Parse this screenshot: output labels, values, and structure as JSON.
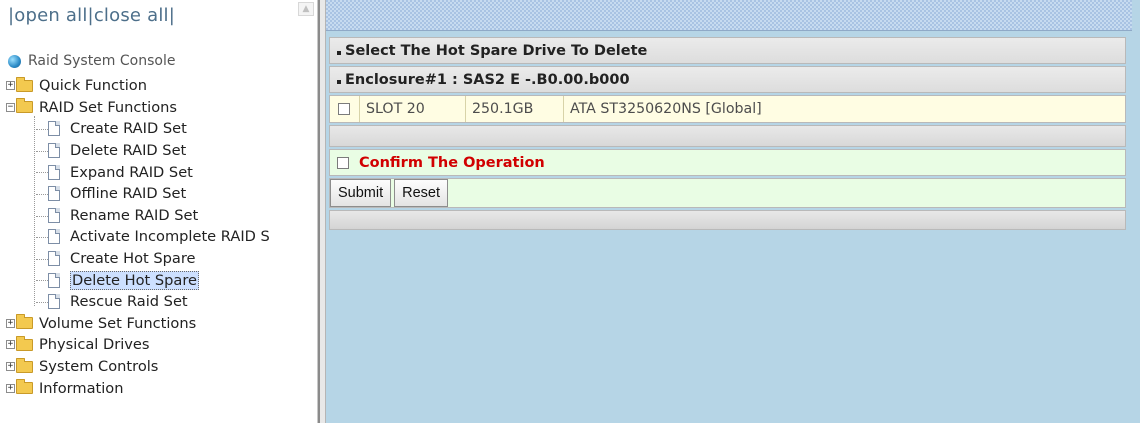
{
  "left": {
    "open_all": "open all",
    "close_all": "close all",
    "sep": "|",
    "root_label": "Raid System Console",
    "nodes": [
      {
        "label": "Quick Function"
      },
      {
        "label": "RAID Set Functions"
      },
      {
        "label": "Create RAID Set"
      },
      {
        "label": "Delete RAID Set"
      },
      {
        "label": "Expand RAID Set"
      },
      {
        "label": "Offline RAID Set"
      },
      {
        "label": "Rename RAID Set"
      },
      {
        "label": "Activate Incomplete RAID S"
      },
      {
        "label": "Create Hot Spare"
      },
      {
        "label": "Delete Hot Spare"
      },
      {
        "label": "Rescue Raid Set"
      },
      {
        "label": "Volume Set Functions"
      },
      {
        "label": "Physical Drives"
      },
      {
        "label": "System Controls"
      },
      {
        "label": "Information"
      }
    ],
    "expand_plus": "+",
    "expand_minus": "−"
  },
  "main": {
    "title": "Select The Hot Spare Drive To Delete",
    "enclosure": "Enclosure#1 : SAS2 E -.B0.00.b000",
    "drive": {
      "slot": "SLOT 20",
      "size": "250.1GB",
      "model": "ATA ST3250620NS [Global]"
    },
    "confirm_label": "Confirm The Operation",
    "submit_label": "Submit",
    "reset_label": "Reset"
  },
  "colors": {
    "confirm_text": "#d10000",
    "right_bg": "#b6d5e6",
    "selected_bg": "#cde0ff"
  },
  "icons": [
    "globe-icon",
    "folder-icon",
    "page-icon",
    "checkbox-icon"
  ]
}
